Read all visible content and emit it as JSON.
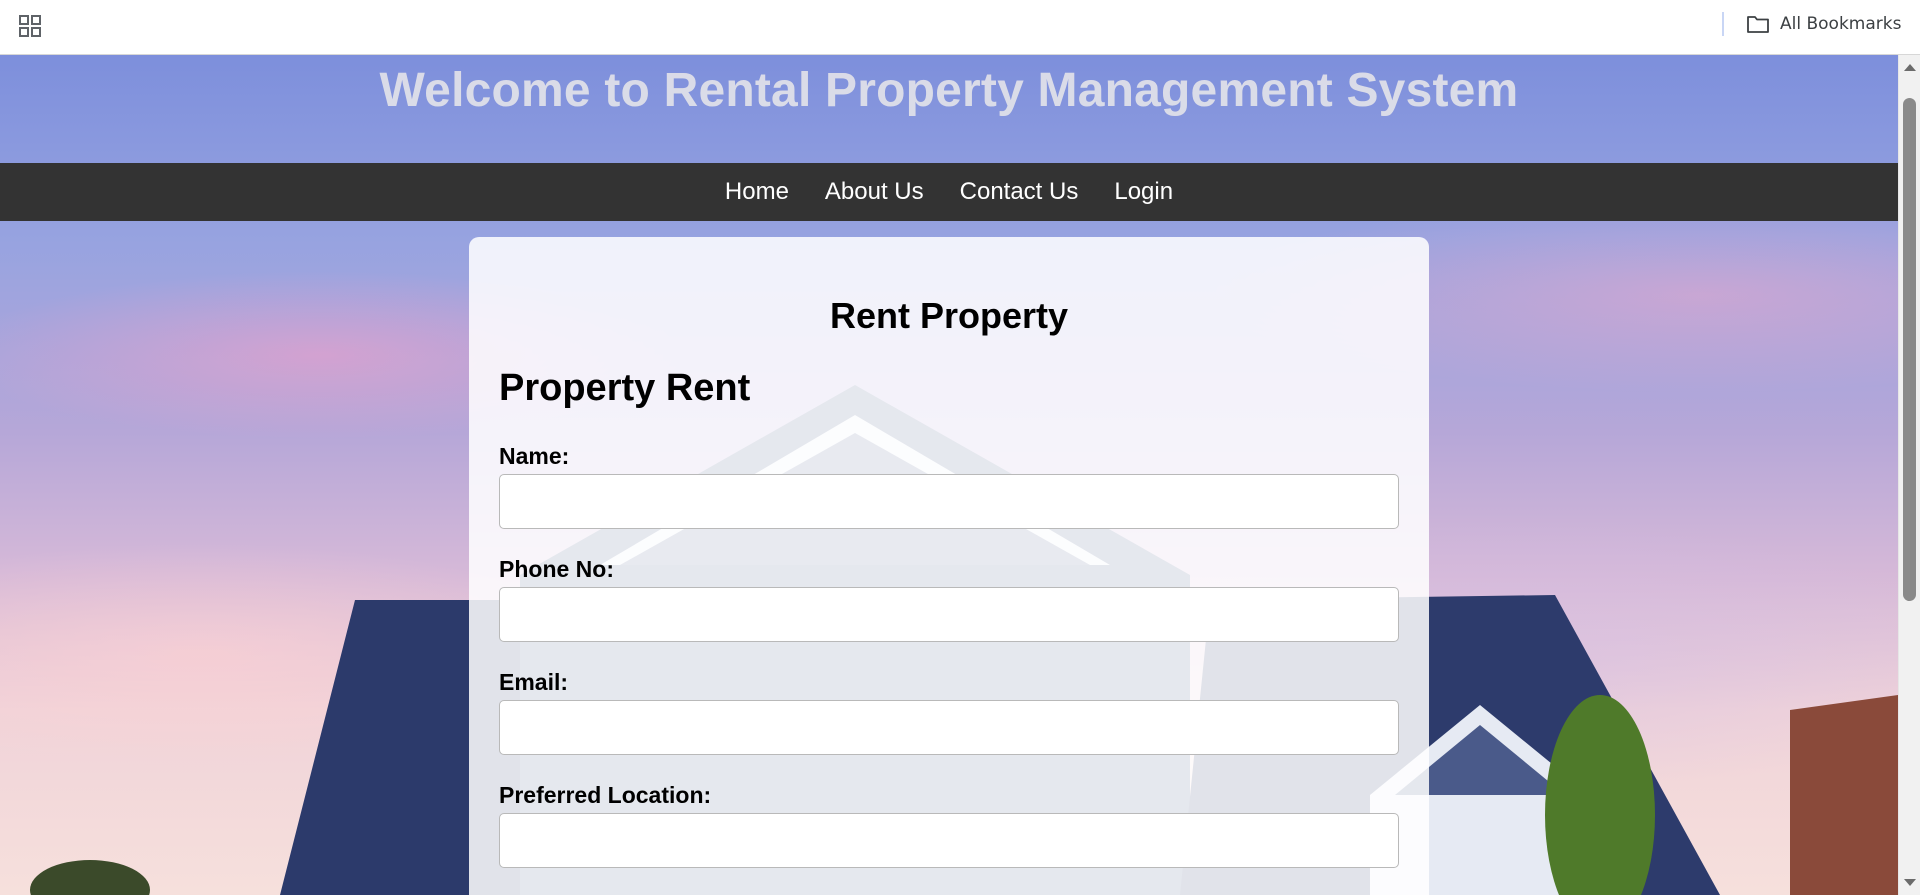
{
  "browser": {
    "apps_icon": "apps-grid-icon",
    "bookmarks_folder_icon": "folder-icon",
    "all_bookmarks_label": "All Bookmarks"
  },
  "header": {
    "title": "Welcome to Rental Property Management System"
  },
  "nav": {
    "items": [
      {
        "label": "Home"
      },
      {
        "label": "About Us"
      },
      {
        "label": "Contact Us"
      },
      {
        "label": "Login"
      }
    ]
  },
  "form": {
    "card_title": "Rent Property",
    "section_title": "Property Rent",
    "fields": [
      {
        "label": "Name:",
        "value": "",
        "placeholder": ""
      },
      {
        "label": "Phone No:",
        "value": "",
        "placeholder": ""
      },
      {
        "label": "Email:",
        "value": "",
        "placeholder": ""
      },
      {
        "label": "Preferred Location:",
        "value": "",
        "placeholder": ""
      }
    ]
  },
  "colors": {
    "navbar_bg": "#333333",
    "nav_text": "#ffffff",
    "title_text": "#e2e2e8",
    "card_bg": "#ffffff"
  }
}
